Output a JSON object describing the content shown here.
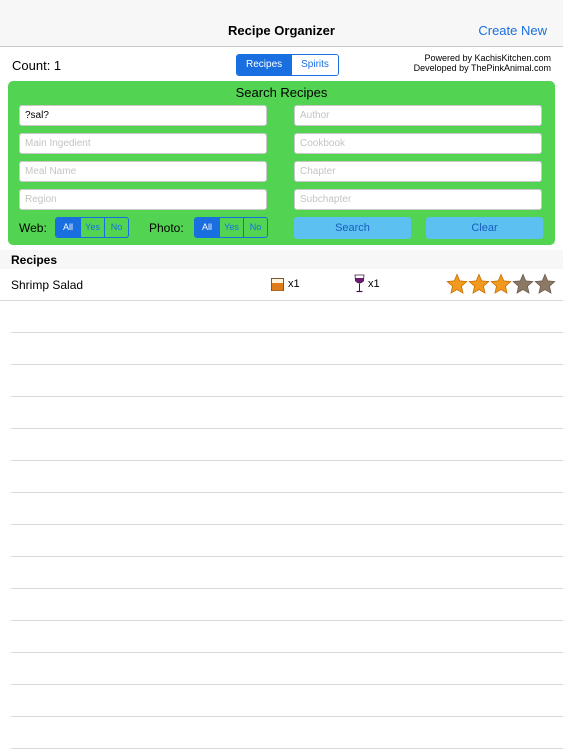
{
  "navbar": {
    "title": "Recipe Organizer",
    "action_label": "Create New"
  },
  "count_label": "Count: 1",
  "category_segment": {
    "options": [
      "Recipes",
      "Spirits"
    ],
    "selected": "Recipes"
  },
  "credits": {
    "line1": "Powered by KachisKitchen.com",
    "line2": "Developed by ThePinkAnimal.com"
  },
  "search_panel": {
    "title": "Search Recipes",
    "fields": {
      "recipe_name": {
        "value": "?sal?",
        "placeholder": ""
      },
      "author": {
        "value": "",
        "placeholder": "Author"
      },
      "main_ingredient": {
        "value": "",
        "placeholder": "Main Ingedient"
      },
      "cookbook": {
        "value": "",
        "placeholder": "Cookbook"
      },
      "meal_name": {
        "value": "",
        "placeholder": "Meal Name"
      },
      "chapter": {
        "value": "",
        "placeholder": "Chapter"
      },
      "region": {
        "value": "",
        "placeholder": "Region"
      },
      "subchapter": {
        "value": "",
        "placeholder": "Subchapter"
      }
    },
    "web_filter": {
      "label": "Web:",
      "options": [
        "All",
        "Yes",
        "No"
      ],
      "selected": "All"
    },
    "photo_filter": {
      "label": "Photo:",
      "options": [
        "All",
        "Yes",
        "No"
      ],
      "selected": "All"
    },
    "search_label": "Search",
    "clear_label": "Clear"
  },
  "list": {
    "section_title": "Recipes",
    "items": [
      {
        "name": "Shrimp Salad",
        "drink_count": "x1",
        "wine_count": "x1",
        "rating": 3,
        "rating_max": 5
      }
    ],
    "empty_rows": 14
  },
  "colors": {
    "accent": "#1a6fe0",
    "panel": "#52d452",
    "button": "#5cc0f0",
    "star_on": "#f29a1f",
    "star_off": "#8b7865"
  }
}
